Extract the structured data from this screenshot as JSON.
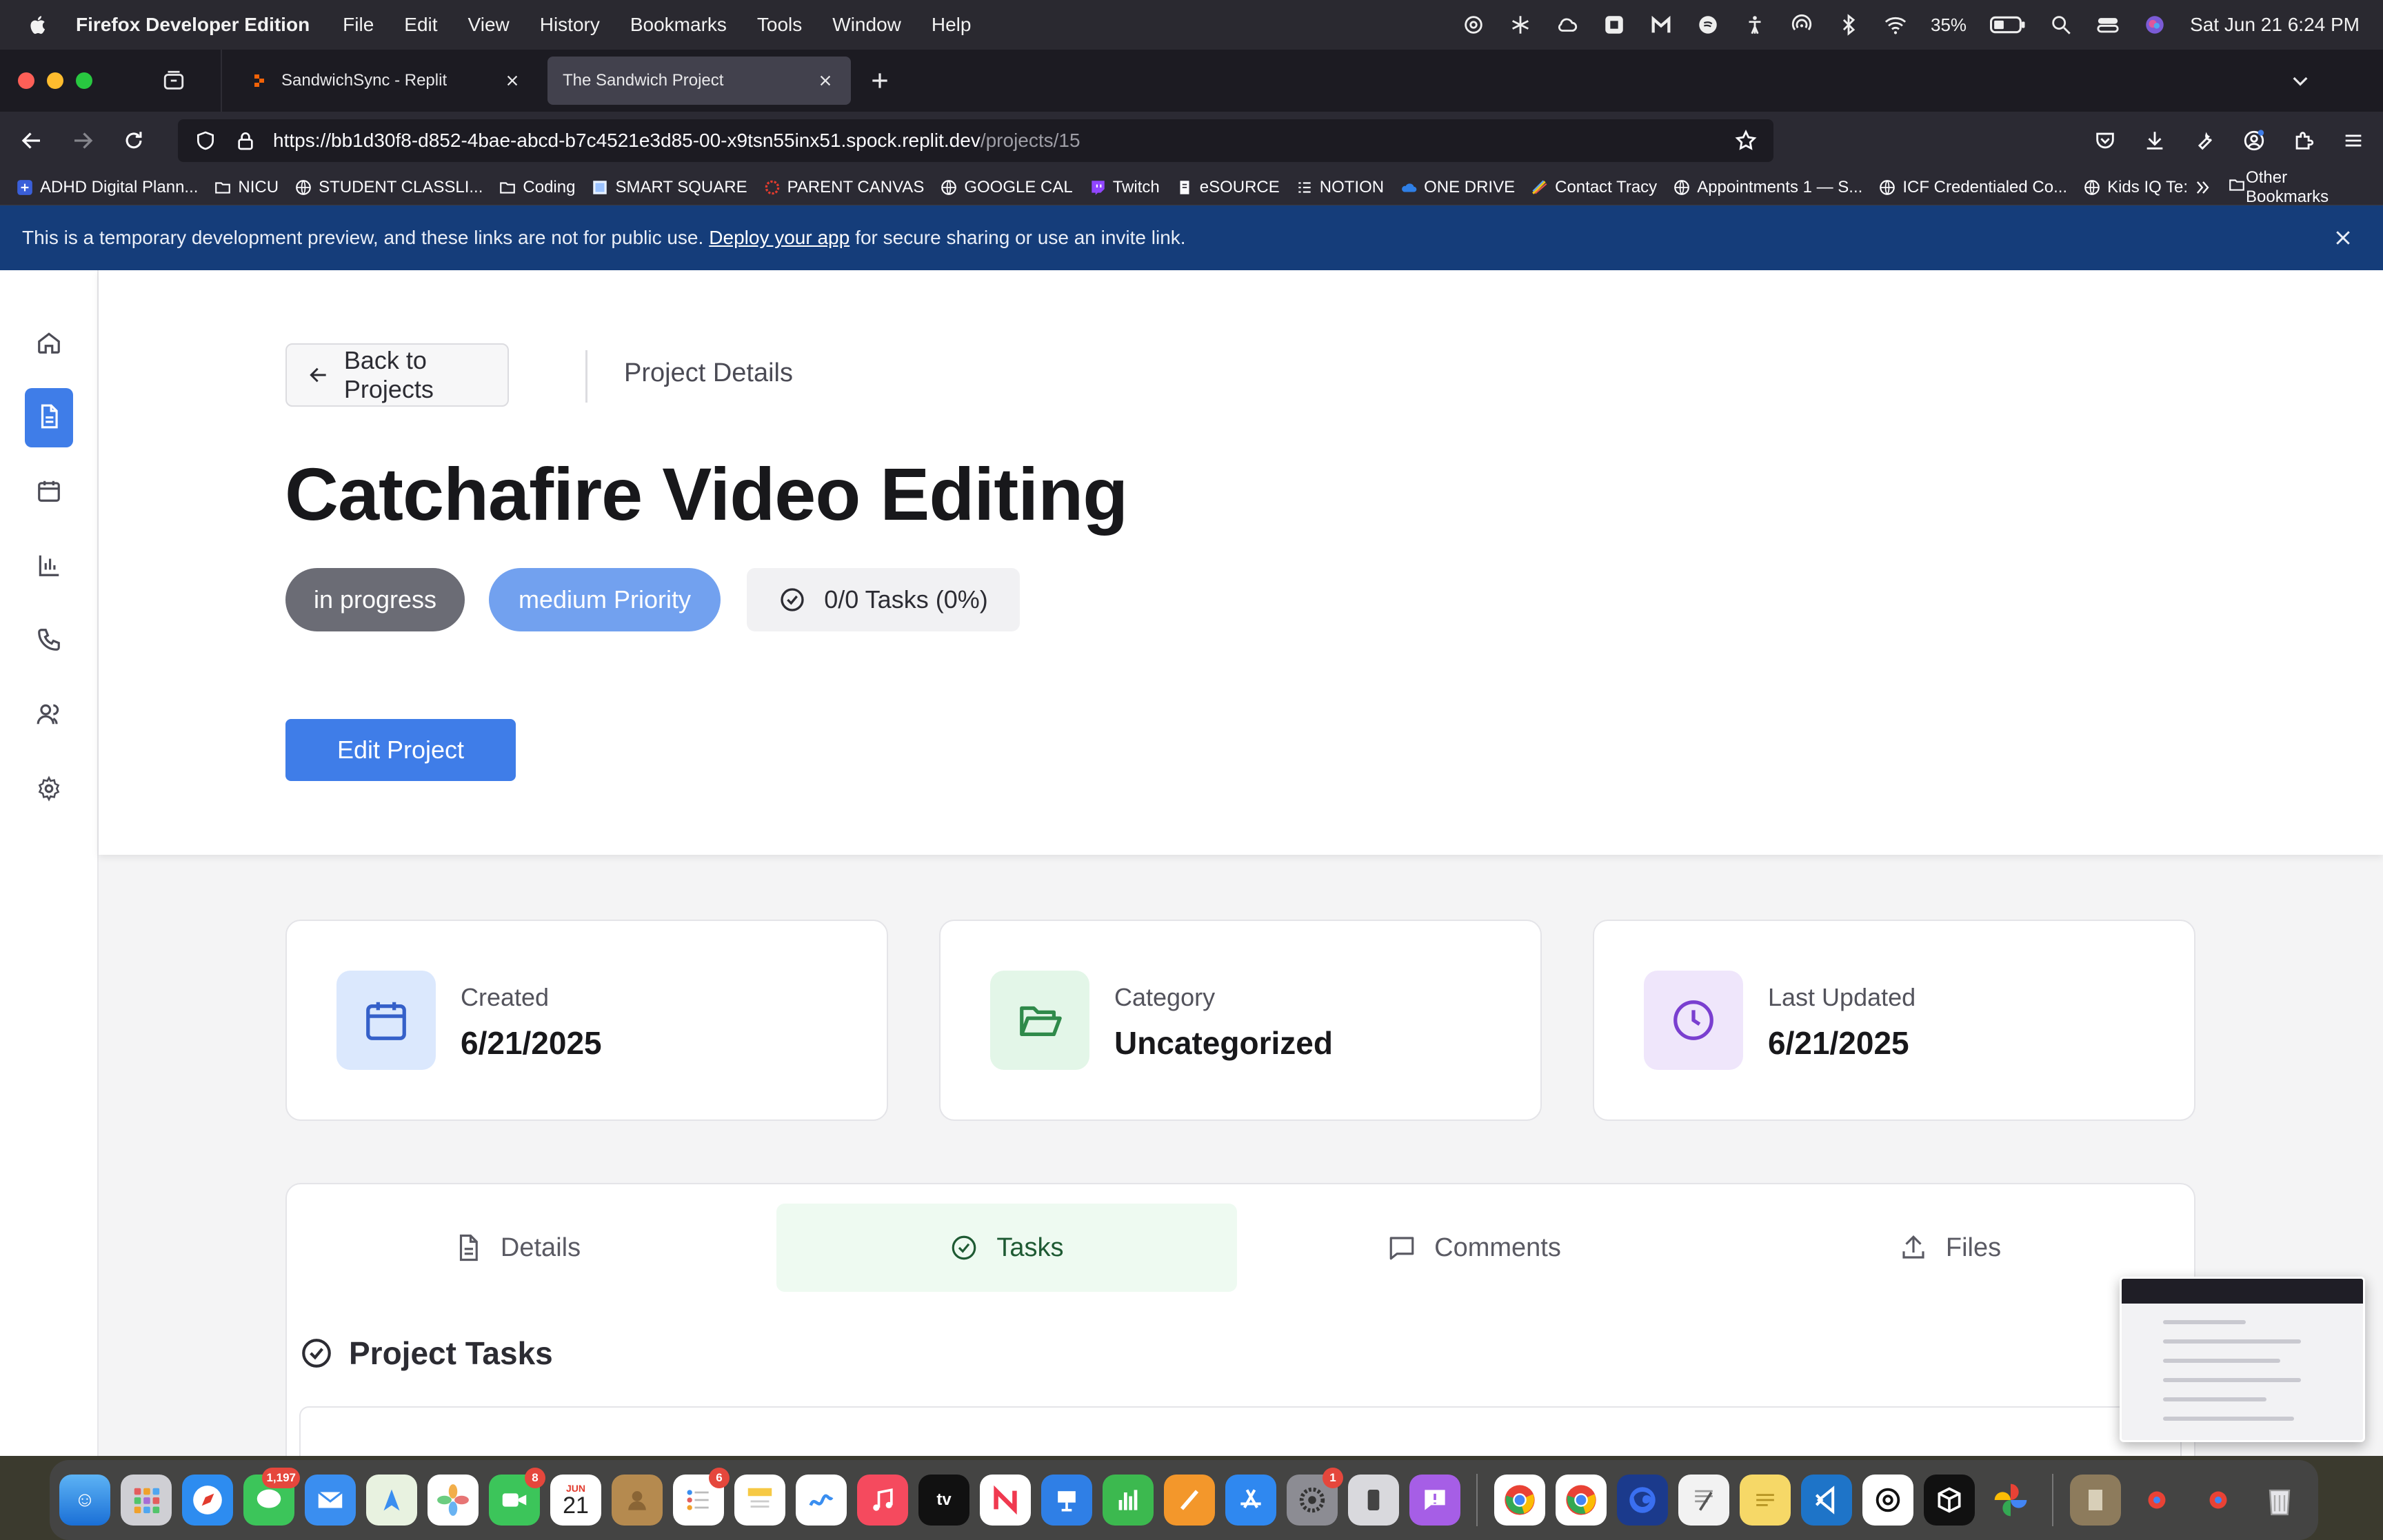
{
  "menubar": {
    "app_name": "Firefox Developer Edition",
    "menus": [
      "File",
      "Edit",
      "View",
      "History",
      "Bookmarks",
      "Tools",
      "Window",
      "Help"
    ],
    "battery": "35%",
    "datetime": "Sat Jun 21  6:24 PM"
  },
  "browser": {
    "tabs": [
      {
        "title": "SandwichSync - Replit",
        "active": false
      },
      {
        "title": "The Sandwich Project",
        "active": true
      }
    ],
    "url_host": "https://bb1d30f8-d852-4bae-abcd-b7c4521e3d85-00-x9tsn55inx51.spock.replit.dev",
    "url_path": "/projects/15",
    "bookmarks": [
      "ADHD Digital Plann...",
      "NICU",
      "STUDENT CLASSLI...",
      "Coding",
      "SMART SQUARE",
      "PARENT CANVAS",
      "GOOGLE CAL",
      "Twitch",
      "eSOURCE",
      "NOTION",
      "ONE DRIVE",
      "Contact Tracy",
      "Appointments 1 — S...",
      "ICF Credentialed Co...",
      "Kids IQ Te:"
    ],
    "other_bookmarks": "Other Bookmarks"
  },
  "banner": {
    "text_before": "This is a temporary development preview, and these links are not for public use.",
    "link": "Deploy your app",
    "text_after": "for secure sharing or use an invite link."
  },
  "page": {
    "back_label": "Back to Projects",
    "breadcrumb": "Project Details",
    "title": "Catchafire Video Editing",
    "status": "in progress",
    "priority": "medium Priority",
    "tasks_summary": "0/0 Tasks (0%)",
    "edit_label": "Edit Project",
    "stats": [
      {
        "label": "Created",
        "value": "6/21/2025",
        "color": "#dbe8fd",
        "icon": "calendar-icon"
      },
      {
        "label": "Category",
        "value": "Uncategorized",
        "color": "#e3f6e8",
        "icon": "folder-open-icon"
      },
      {
        "label": "Last Updated",
        "value": "6/21/2025",
        "color": "#efe6fb",
        "icon": "clock-icon"
      }
    ],
    "tabs": [
      {
        "label": "Details",
        "active": false
      },
      {
        "label": "Tasks",
        "active": true
      },
      {
        "label": "Comments",
        "active": false
      },
      {
        "label": "Files",
        "active": false
      }
    ],
    "section_title": "Project Tasks"
  },
  "dock": {
    "badges": {
      "messages": "1,197",
      "facetime": "8",
      "calendar_day": "21",
      "calendar_month": "JUN",
      "reminders": "6",
      "settings": "1"
    }
  },
  "colors": {
    "accent": "#3f7de8",
    "status_pill": "#6b6c75",
    "priority_pill": "#72a1ef",
    "banner": "#153d7a"
  }
}
